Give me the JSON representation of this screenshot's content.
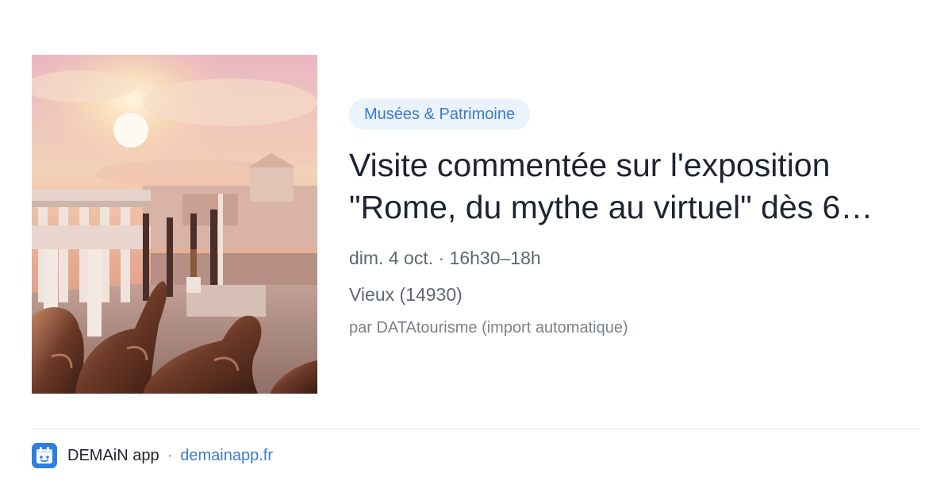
{
  "event": {
    "category": "Musées & Patrimoine",
    "title": "Visite commentée sur l'exposition \"Rome, du mythe au virtuel\" dès 6…",
    "date": "dim. 4 oct. · 16h30–18h",
    "location": "Vieux (14930)",
    "source": "par DATAtourisme (import automatique)",
    "image": "rome-virtual-forum-photo"
  },
  "footer": {
    "app_name": "DEMAiN app",
    "separator": "·",
    "domain": "demainapp.fr",
    "icon": "demain-app-icon"
  },
  "colors": {
    "accent": "#3a7bd5",
    "tag_background": "#eaf2fb",
    "title": "#1d2330",
    "meta": "#5f6673"
  }
}
